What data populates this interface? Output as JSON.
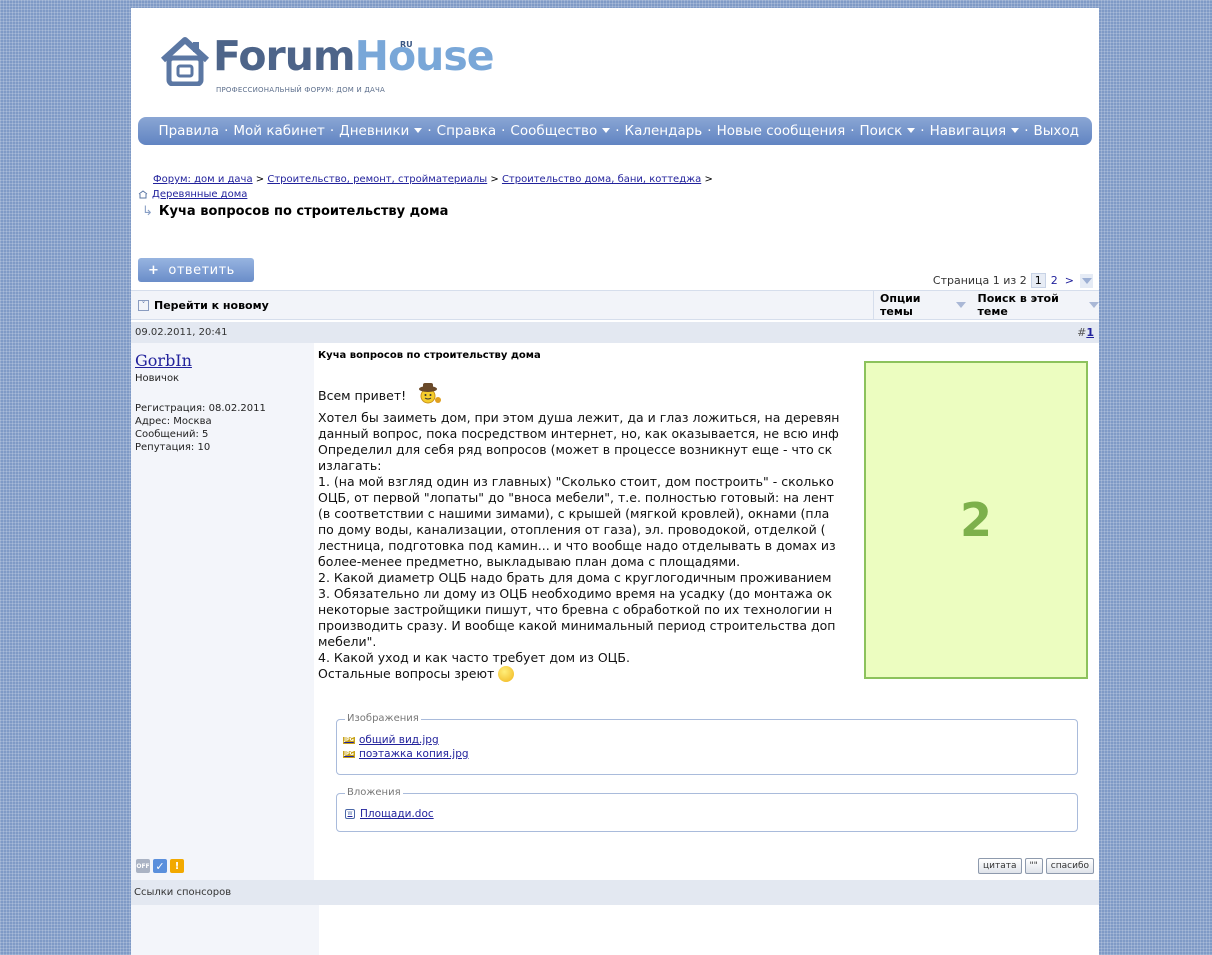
{
  "logo": {
    "part1": "Forum",
    "part2": "House",
    "ru": "RU",
    "tagline": "ПРОФЕССИОНАЛЬНЫЙ ФОРУМ: ДОМ И ДАЧА"
  },
  "nav": {
    "items": [
      "Правила",
      "Мой кабинет",
      "Дневники",
      "Справка",
      "Сообщество",
      "Календарь",
      "Новые сообщения",
      "Поиск",
      "Навигация",
      "Выход"
    ]
  },
  "breadcrumb": {
    "root": "Форум: дом и дача",
    "l1": "Строительство, ремонт, стройматериалы",
    "l2": "Строительство дома, бани, коттеджа",
    "l3": "Деревянные дома",
    "current": "Куча вопросов по строительству дома",
    "sep": ">"
  },
  "reply_button": "ответить",
  "pager": {
    "label": "Страница 1 из 2",
    "current": "1",
    "next_page": "2",
    "next": ">"
  },
  "toolbar": {
    "go_new": "Перейти к новому",
    "thread_options": "Опции темы",
    "search_thread": "Поиск в этой теме"
  },
  "post": {
    "date": "09.02.2011, 20:41",
    "number_prefix": "#",
    "number": "1",
    "title": "Куча вопросов по строительству дома",
    "lines": [
      "Всем привет!",
      "Хотел бы заиметь дом, при этом душа лежит, да и глаз ложиться, на деревян",
      "данный вопрос, пока посредством интернет, но, как оказывается, не всю инф",
      "Определил для себя ряд вопросов (может в процессе возникнут еще - что ск",
      "излагать:",
      "1. (на мой взгляд один из главных) \"Сколько стоит, дом построить\" - сколько",
      "ОЦБ, от первой \"лопаты\" до \"вноса мебели\", т.е. полностью готовый: на лент",
      "(в соответствии с нашими зимами), с крышей (мягкой кровлей), окнами (пла",
      "по дому воды, канализации, отопления от газа), эл. проводокой, отделкой (",
      "лестница, подготовка под камин... и что вообще надо отделывать в домах из",
      "более-менее предметно, выкладываю план дома с площадями.",
      "2. Какой диаметр ОЦБ надо брать для дома с круглогодичным проживанием",
      "3. Обязательно ли дому из ОЦБ необходимо время на усадку (до монтажа ок",
      "некоторые застройщики пишут, что бревна с обработкой по их технологии н",
      "производить сразу. И вообще какой минимальный период строительства доп",
      "мебели\".",
      "4. Какой уход и как часто требует дом из ОЦБ.",
      "Остальные вопросы зреют"
    ],
    "image_placeholder": "2"
  },
  "user": {
    "name": "GorbIn",
    "rank": "Новичок",
    "registration": "Регистрация: 08.02.2011",
    "address": "Адрес: Москва",
    "posts": "Сообщений: 5",
    "reputation": "Репутация: 10",
    "status_off": "OFF"
  },
  "images_block": {
    "legend": "Изображения",
    "files": [
      "общий вид.jpg",
      "поэтажка копия.jpg"
    ]
  },
  "attachments_block": {
    "legend": "Вложения",
    "files": [
      "Площади.doc"
    ]
  },
  "post_buttons": {
    "quote": "цитата",
    "multi_quote": "\"\"",
    "thanks": "спасибо"
  },
  "sponsors": "Ссылки спонсоров",
  "colors": {
    "brand": "#4d6489",
    "nav_bg": "#6f90c8",
    "link": "#22229c",
    "placeholder_fill": "#ecfdc0",
    "placeholder_border": "#8cc25c"
  }
}
